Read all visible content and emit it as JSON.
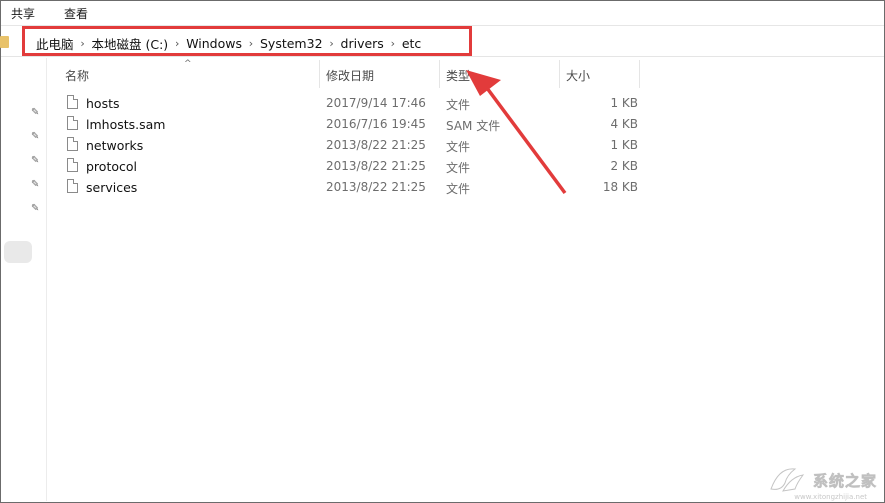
{
  "ribbon": {
    "tabs": [
      "共享",
      "查看"
    ]
  },
  "breadcrumb": [
    "此电脑",
    "本地磁盘 (C:)",
    "Windows",
    "System32",
    "drivers",
    "etc"
  ],
  "columns": {
    "name": "名称",
    "date": "修改日期",
    "type": "类型",
    "size": "大小"
  },
  "files": [
    {
      "name": "hosts",
      "date": "2017/9/14 17:46",
      "type": "文件",
      "size": "1 KB"
    },
    {
      "name": "lmhosts.sam",
      "date": "2016/7/16 19:45",
      "type": "SAM 文件",
      "size": "4 KB"
    },
    {
      "name": "networks",
      "date": "2013/8/22 21:25",
      "type": "文件",
      "size": "1 KB"
    },
    {
      "name": "protocol",
      "date": "2013/8/22 21:25",
      "type": "文件",
      "size": "2 KB"
    },
    {
      "name": "services",
      "date": "2013/8/22 21:25",
      "type": "文件",
      "size": "18 KB"
    }
  ],
  "watermark": {
    "text": "系统之家",
    "url": "www.xitongzhijia.net"
  },
  "colors": {
    "annotation": "#e23b3b",
    "folder": "#e8c26a"
  },
  "icons": {
    "file": "file-icon",
    "pin": "pin-icon",
    "folder": "folder-icon",
    "chevron": "chevron-right-icon"
  }
}
